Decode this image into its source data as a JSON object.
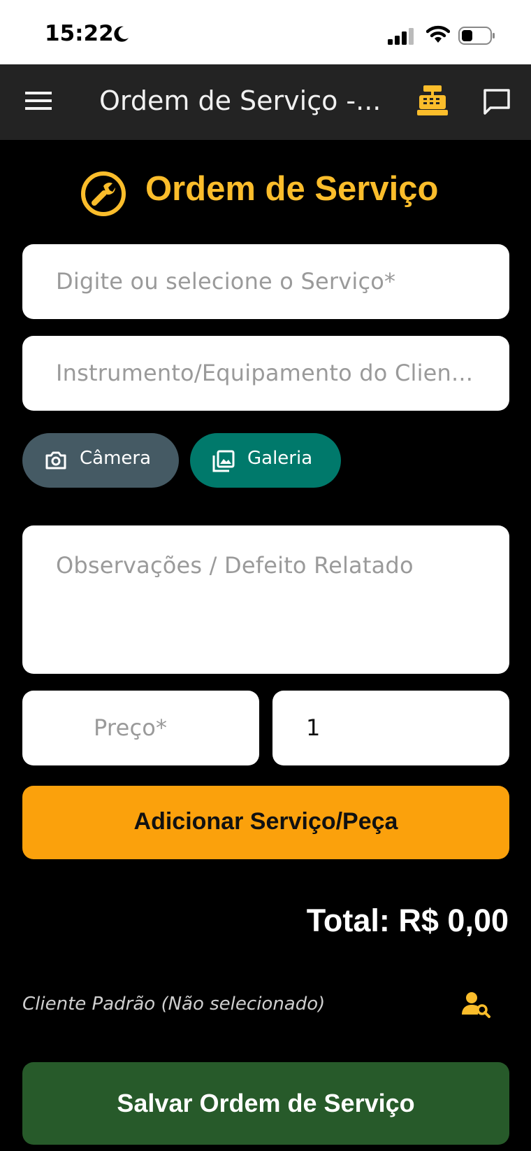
{
  "status_bar": {
    "time": "15:22"
  },
  "app_bar": {
    "title": "Ordem de Serviço -..."
  },
  "form": {
    "heading": "Ordem de Serviço",
    "service_placeholder": "Digite ou selecione o Serviço*",
    "instrument_placeholder": "Instrumento/Equipamento do Clien...",
    "camera_label": "Câmera",
    "gallery_label": "Galeria",
    "notes_placeholder": "Observações / Defeito Relatado",
    "price_placeholder": "Preço*",
    "quantity_value": "1",
    "add_label": "Adicionar Serviço/Peça",
    "total": "Total: R$ 0,00",
    "client": "Cliente Padrão (Não selecionado)",
    "save_label": "Salvar Ordem de Serviço"
  },
  "colors": {
    "accent_yellow": "#fbbd2b",
    "add_button": "#fba10c",
    "save_button": "#275a2a",
    "camera_button": "#455a64",
    "gallery_button": "#00796b",
    "app_bar": "#232323"
  },
  "icons": [
    "moon-icon",
    "signal-icon",
    "wifi-icon",
    "battery-icon",
    "menu-icon",
    "cash-register-icon",
    "chat-icon",
    "wrench-icon",
    "camera-icon",
    "gallery-icon",
    "user-search-icon"
  ]
}
